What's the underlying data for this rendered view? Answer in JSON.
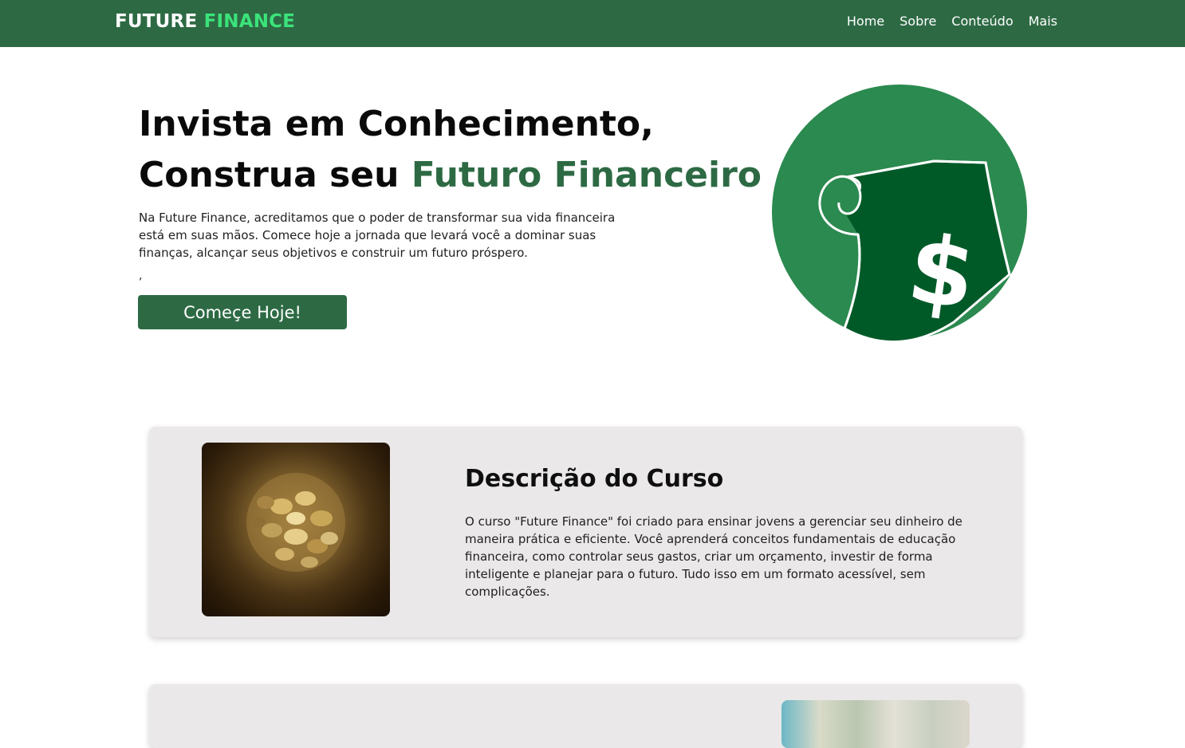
{
  "navbar": {
    "brand_primary": "FUTURE",
    "brand_accent": "FINANCE",
    "links": [
      "Home",
      "Sobre",
      "Conteúdo",
      "Mais"
    ]
  },
  "hero": {
    "title_line1": "Invista em Conhecimento,",
    "title_line2_prefix": "Construa seu",
    "title_line2_highlight": "Futuro Financeiro",
    "description": "Na Future Finance, acreditamos que o poder de transformar sua vida financeira está em suas mãos. Comece hoje a jornada que levará você a dominar suas finanças, alcançar seus objetivos e construir um futuro próspero.",
    "stray_text": ",",
    "cta_label": "Começe Hoje!",
    "illustration_icon": "dollar-scroll-icon"
  },
  "course_card": {
    "title": "Descrição do Curso",
    "text": "O curso \"Future Finance\" foi criado para ensinar jovens a gerenciar seu dinheiro de maneira prática e eficiente. Você aprenderá conceitos fundamentais de educação financeira, como controlar seus gastos, criar um orçamento, investir de forma inteligente e planejar para o futuro. Tudo isso em um formato acessível, sem complicações.",
    "image": "coins-jar-photo"
  },
  "second_card": {
    "image": "money-bills-photo"
  },
  "colors": {
    "nav_bg": "#2d6a44",
    "brand_accent": "#3be37a",
    "highlight_green": "#2d6a44",
    "circle_green": "#2b8a4f",
    "bill_green": "#005a28",
    "card_bg": "#ebe8e9"
  }
}
